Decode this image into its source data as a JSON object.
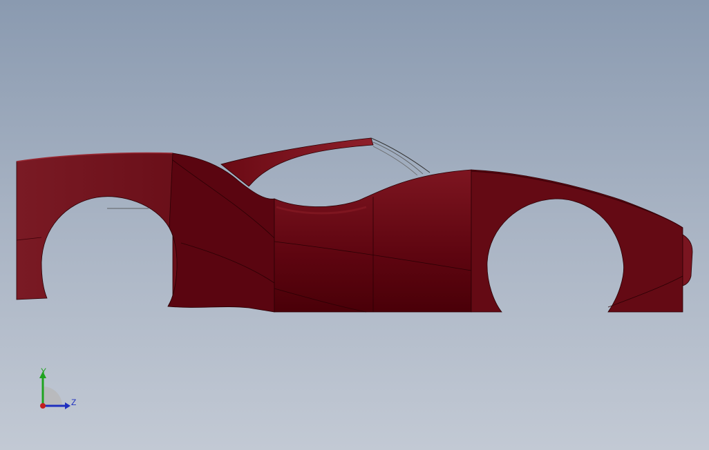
{
  "viewport": {
    "background_top": "#8a9ab0",
    "background_bottom": "#c2c9d4"
  },
  "model": {
    "body_color": "#6e0a14",
    "shade_color": "#4d0008",
    "highlight_color": "#8a1c26",
    "edge_color": "#2a0004"
  },
  "triad": {
    "y_label": "Y",
    "z_label": "Z",
    "y_color": "#1fa31f",
    "z_color": "#1f2fbf",
    "x_color": "#c21f1f"
  }
}
